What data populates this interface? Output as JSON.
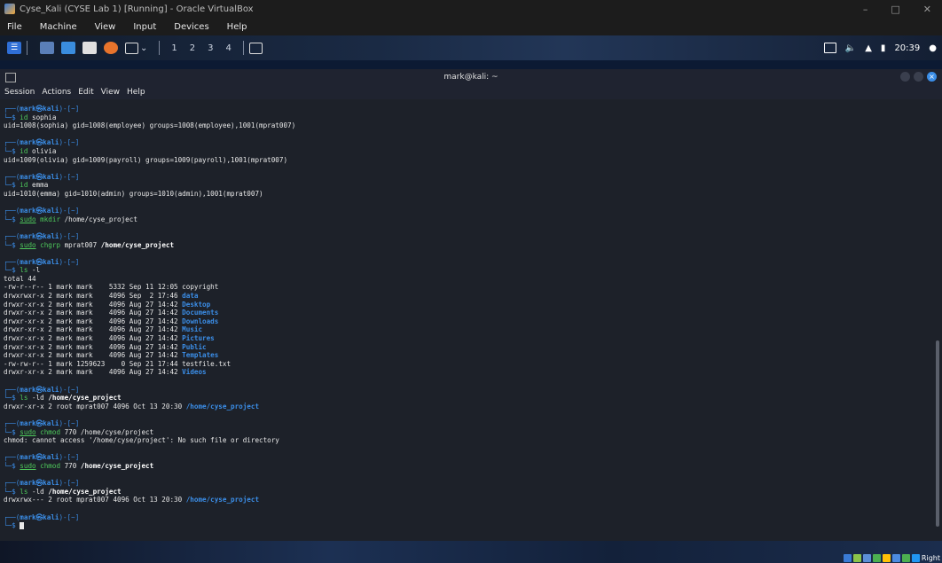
{
  "vbox": {
    "title": "Cyse_Kali (CYSE Lab 1) [Running] - Oracle VirtualBox",
    "window_buttons": [
      "–",
      "□",
      "✕"
    ],
    "menu": [
      "File",
      "Machine",
      "View",
      "Input",
      "Devices",
      "Help"
    ],
    "status_right_ctrl": "Right"
  },
  "panel": {
    "workspaces": [
      "1",
      "2",
      "3",
      "4"
    ],
    "clock": "20:39"
  },
  "terminal": {
    "title": "mark@kali: ~",
    "menu": [
      "Session",
      "Actions",
      "Edit",
      "View",
      "Help"
    ],
    "prompt_line1": "┌──(",
    "prompt_user": "mark㉿kali",
    "prompt_line1_end": ")-[~]",
    "prompt_line2": "└─$ ",
    "commands": [
      {
        "sudo": "",
        "cmd": "id",
        "args": " sophia",
        "bold": "",
        "output": [
          "uid=1008(sophia) gid=1008(employee) groups=1008(employee),1001(mprat007)"
        ]
      },
      {
        "sudo": "",
        "cmd": "id",
        "args": " olivia",
        "bold": "",
        "output": [
          "uid=1009(olivia) gid=1009(payroll) groups=1009(payroll),1001(mprat007)"
        ]
      },
      {
        "sudo": "",
        "cmd": "id",
        "args": " emma",
        "bold": "",
        "output": [
          "uid=1010(emma) gid=1010(admin) groups=1010(admin),1001(mprat007)"
        ]
      },
      {
        "sudo": "sudo",
        "cmd": " mkdir",
        "args": " /home/cyse_project",
        "bold": "",
        "output": []
      },
      {
        "sudo": "sudo",
        "cmd": " chgrp",
        "args": " mprat007 ",
        "bold": "/home/cyse_project",
        "output": []
      }
    ],
    "ls_cmd": {
      "cmd": "ls",
      "args": " -l"
    },
    "ls_total": "total 44",
    "ls_rows": [
      {
        "meta": "-rw-r--r-- 1 mark mark    5332 Sep 11 12:05 ",
        "name": "copyright",
        "dir": false
      },
      {
        "meta": "drwxrwxr-x 2 mark mark    4096 Sep  2 17:46 ",
        "name": "data",
        "dir": true
      },
      {
        "meta": "drwxr-xr-x 2 mark mark    4096 Aug 27 14:42 ",
        "name": "Desktop",
        "dir": true
      },
      {
        "meta": "drwxr-xr-x 2 mark mark    4096 Aug 27 14:42 ",
        "name": "Documents",
        "dir": true
      },
      {
        "meta": "drwxr-xr-x 2 mark mark    4096 Aug 27 14:42 ",
        "name": "Downloads",
        "dir": true
      },
      {
        "meta": "drwxr-xr-x 2 mark mark    4096 Aug 27 14:42 ",
        "name": "Music",
        "dir": true
      },
      {
        "meta": "drwxr-xr-x 2 mark mark    4096 Aug 27 14:42 ",
        "name": "Pictures",
        "dir": true
      },
      {
        "meta": "drwxr-xr-x 2 mark mark    4096 Aug 27 14:42 ",
        "name": "Public",
        "dir": true
      },
      {
        "meta": "drwxr-xr-x 2 mark mark    4096 Aug 27 14:42 ",
        "name": "Templates",
        "dir": true
      },
      {
        "meta": "-rw-rw-r-- 1 mark 1259623    0 Sep 21 17:44 ",
        "name": "testfile.txt",
        "dir": false
      },
      {
        "meta": "drwxr-xr-x 2 mark mark    4096 Aug 27 14:42 ",
        "name": "Videos",
        "dir": true
      }
    ],
    "ld1": {
      "cmd": "ls",
      "args": " -ld ",
      "bold": "/home/cyse_project",
      "meta": "drwxr-xr-x 2 root mprat007 4096 Oct 13 20:30 ",
      "name": "/home/cyse_project"
    },
    "chmod_err": {
      "sudo": "sudo",
      "cmd": " chmod",
      "args": " 770 /home/cyse/project",
      "output": "chmod: cannot access '/home/cyse/project': No such file or directory"
    },
    "chmod_ok": {
      "sudo": "sudo",
      "cmd": " chmod",
      "args": " 770 ",
      "bold": "/home/cyse_project"
    },
    "ld2": {
      "cmd": "ls",
      "args": " -ld ",
      "bold": "/home/cyse_project",
      "meta": "drwxrwx--- 2 root mprat007 4096 Oct 13 20:30 ",
      "name": "/home/cyse_project"
    }
  },
  "colors": {
    "prompt_blue": "#3b8ee8",
    "cmd_green": "#4ec95b",
    "terminal_bg": "#1d2129"
  }
}
